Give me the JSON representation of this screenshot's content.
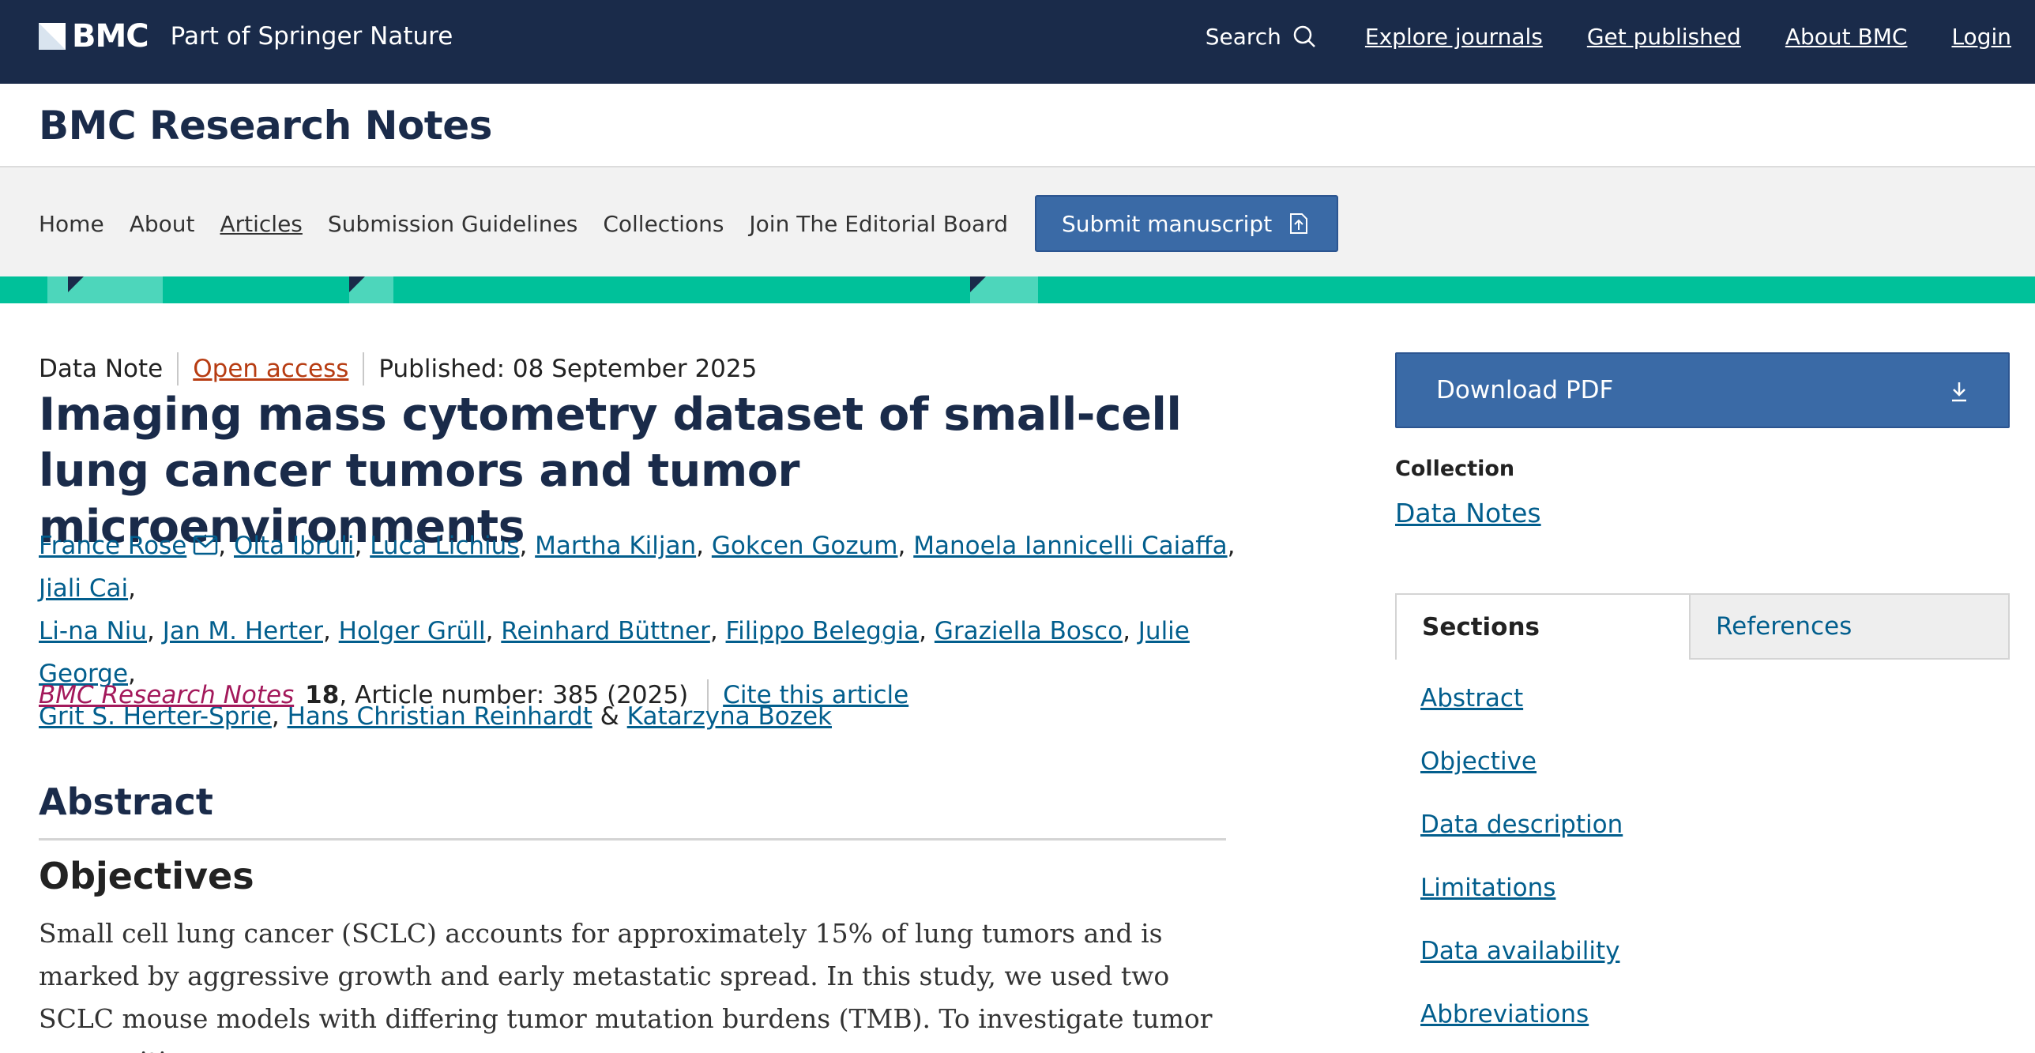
{
  "header": {
    "brand_name": "BMC",
    "brand_part": "Part of Springer Nature",
    "search_label": "Search",
    "nav": [
      "Explore journals",
      "Get published",
      "About BMC",
      "Login"
    ]
  },
  "journal": {
    "title": "BMC Research Notes"
  },
  "subnav": {
    "items": [
      "Home",
      "About",
      "Articles",
      "Submission Guidelines",
      "Collections",
      "Join The Editorial Board"
    ],
    "active": "Articles",
    "submit_label": "Submit manuscript"
  },
  "article": {
    "type": "Data Note",
    "access": "Open access",
    "published": "Published: 08 September 2025",
    "title": "Imaging mass cytometry dataset of small-cell lung cancer tumors and tumor microenvironments",
    "authors": [
      "France Rose",
      "Olta Ibruli",
      "Luca Lichius",
      "Martha Kiljan",
      "Gokcen Gozum",
      "Manoela Iannicelli Caiaffa",
      "Jiali Cai",
      "Li-na Niu",
      "Jan M. Herter",
      "Holger Grüll",
      "Reinhard Büttner",
      "Filippo Beleggia",
      "Graziella Bosco",
      "Julie George",
      "Grit S. Herter-Sprie",
      "Hans Christian Reinhardt",
      "Katarzyna Bozek"
    ],
    "journal_name": "BMC Research Notes",
    "volume": "18",
    "article_number": ", Article number: 385 (2025)",
    "cite_label": "Cite this article"
  },
  "abstract": {
    "heading": "Abstract",
    "subheading": "Objectives",
    "text": "Small cell lung cancer (SCLC) accounts for approximately 15% of lung tumors and is marked by aggressive growth and early metastatic spread. In this study, we used two SCLC mouse models with differing tumor mutation burdens (TMB). To investigate tumor composition,"
  },
  "sidebar": {
    "download_label": "Download PDF",
    "collection_label": "Collection",
    "collection_link": "Data Notes",
    "tabs": {
      "sections": "Sections",
      "references": "References"
    },
    "toc": [
      "Abstract",
      "Objective",
      "Data description",
      "Limitations",
      "Data availability",
      "Abbreviations"
    ]
  },
  "colors": {
    "header_bg": "#1a2b4a",
    "accent_teal": "#00c19a",
    "button_blue": "#3a6aa6",
    "link": "#025e8d",
    "open_access": "#b73c12",
    "journal_link": "#a3195b"
  },
  "icons": [
    "bmc-logo-icon",
    "search-icon",
    "submit-icon",
    "mail-icon",
    "download-icon"
  ]
}
